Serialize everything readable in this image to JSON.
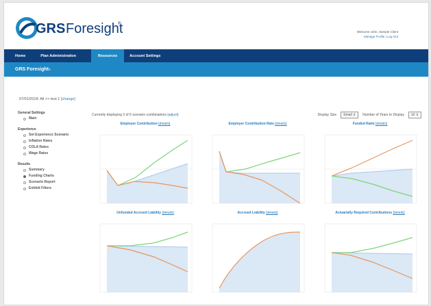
{
  "brand": {
    "logo_text_prefix": "GRS",
    "logo_text_suffix": "Foresight",
    "logo_mark": "®",
    "colors": {
      "navy": "#0f3f7a",
      "blue": "#1e88c4",
      "link": "#2a7ab8",
      "orange": "#e8955a",
      "green": "#7dd47a",
      "area": "#dbe8f6",
      "arealine": "#a7c7ea"
    }
  },
  "header": {
    "welcome": "Welcome John, Sample Client",
    "manage_profile": "Manage Profile",
    "logout": "Log Out"
  },
  "nav": {
    "items": [
      {
        "label": "Home",
        "active": false
      },
      {
        "label": "Plan Administration",
        "active": false
      },
      {
        "label": "Resources",
        "active": true
      },
      {
        "label": "Account Settings",
        "active": false
      }
    ]
  },
  "subbar": {
    "title": "GRS Foresight",
    "mark": "®"
  },
  "scenario_line": {
    "text": "07/01/2018: All >> test 1",
    "change": "[change]"
  },
  "sidebar": {
    "groups": [
      {
        "label": "General Settings",
        "items": [
          {
            "label": "Main",
            "checked": false
          }
        ]
      },
      {
        "label": "Experience",
        "items": [
          {
            "label": "Set Experience Scenario",
            "checked": false
          },
          {
            "label": "Inflation Rates",
            "checked": false
          },
          {
            "label": "COLA Rates",
            "checked": false
          },
          {
            "label": "Wage Rates",
            "checked": false
          }
        ]
      },
      {
        "label": "Results",
        "items": [
          {
            "label": "Summary",
            "checked": false
          },
          {
            "label": "Funding Charts",
            "checked": true
          },
          {
            "label": "Scenario Report",
            "checked": false
          },
          {
            "label": "Exhibit Filters",
            "checked": false
          }
        ]
      }
    ]
  },
  "controls": {
    "displaying": "Currently displaying 3 of 6 scenario combinations",
    "adjust": "[adjust]",
    "display_size_label": "Display Size",
    "display_size_value": "Small ⇕",
    "years_label": "Number of Years to Display",
    "years_value": "10 ⇕"
  },
  "charts": [
    {
      "title": "Employer Contribution",
      "details": "[details]"
    },
    {
      "title": "Employer Contribution Rate",
      "details": "[details]"
    },
    {
      "title": "Funded Ratio",
      "details": "[details]"
    },
    {
      "title": "Unfunded Accrued Liability",
      "details": "[details]"
    },
    {
      "title": "Accrued Liability",
      "details": "[details]"
    },
    {
      "title": "Actuarially Required Contributions",
      "details": "[details]"
    }
  ]
}
